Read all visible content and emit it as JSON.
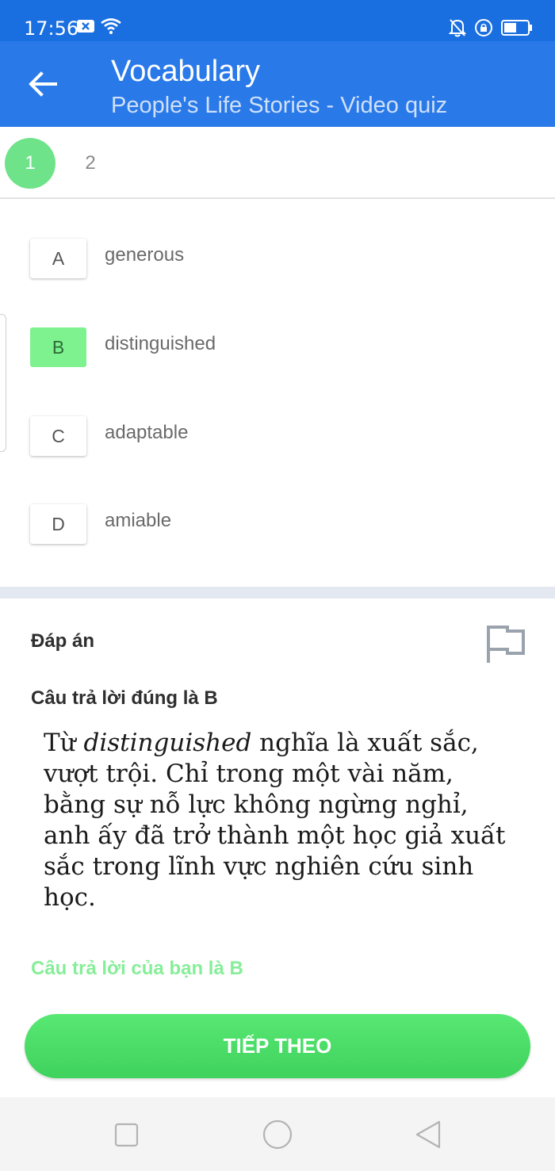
{
  "status_bar": {
    "time": "17:56",
    "icons_left": [
      "x-notification-icon",
      "wifi-icon"
    ],
    "icons_right": [
      "bell-off-icon",
      "lock-rotation-icon",
      "battery-icon"
    ]
  },
  "app_bar": {
    "title": "Vocabulary",
    "subtitle": "People's Life Stories - Video quiz",
    "back_icon": "arrow-left-icon"
  },
  "question_nav": {
    "steps": [
      {
        "label": "1",
        "active": true
      },
      {
        "label": "2",
        "active": false
      }
    ]
  },
  "options": [
    {
      "letter": "A",
      "text": "generous",
      "selected": false
    },
    {
      "letter": "B",
      "text": "distinguished",
      "selected": true
    },
    {
      "letter": "C",
      "text": "adaptable",
      "selected": false
    },
    {
      "letter": "D",
      "text": "amiable",
      "selected": false
    }
  ],
  "answer": {
    "title": "Đáp án",
    "correct_line": "Câu trả lời đúng là B",
    "explanation_prefix": "Từ ",
    "explanation_term": "distinguished",
    "explanation_rest": " nghĩa là xuất sắc, vượt trội. Chỉ trong một vài năm, bằng sự nỗ lực không ngừng nghỉ, anh ấy đã trở thành một học giả xuất sắc trong lĩnh vực nghiên cứu sinh học.",
    "your_answer": "Câu trả lời của bạn là B",
    "flag_icon": "flag-icon"
  },
  "next_button": {
    "label": "TIẾP THEO"
  },
  "colors": {
    "status_bar": "#1a6fe0",
    "app_bar": "#2979e8",
    "accent_green": "#4ade66",
    "selected_option": "#7df28f"
  }
}
